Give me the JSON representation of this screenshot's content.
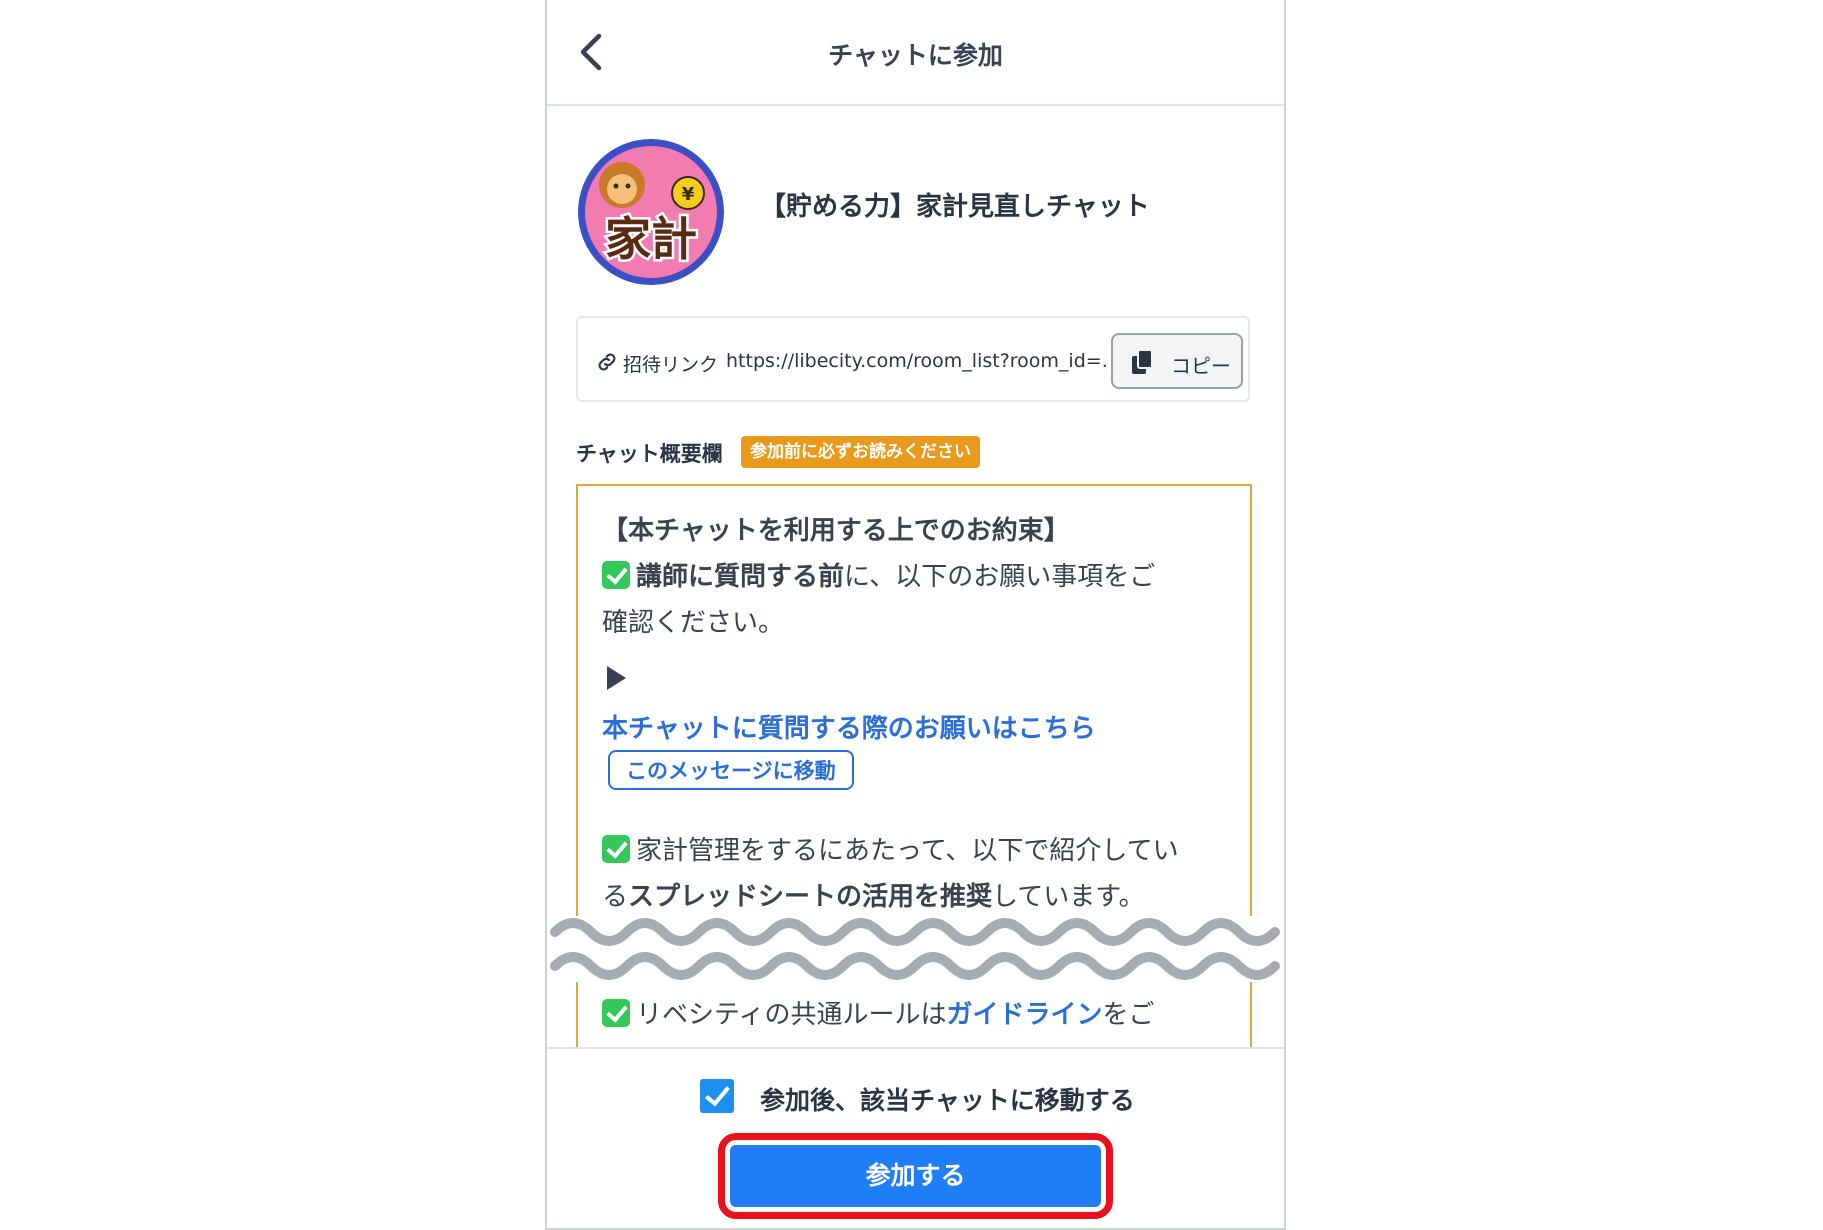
{
  "header": {
    "title": "チャットに参加",
    "back_icon": "chevron-left-icon"
  },
  "chat": {
    "name": "【貯める力】家計見直しチャット",
    "avatar_text": "家計"
  },
  "invite": {
    "label": "招待リンク",
    "url": "https://libecity.com/room_list?room_id=...",
    "copy_label": "コピー"
  },
  "summary": {
    "label": "チャット概要欄",
    "badge": "参加前に必ずお読みください",
    "heading": "【本チャットを利用する上でのお約束】",
    "item1_bold": "講師に質問する前",
    "item1_rest": "に、以下のお願い事項をご",
    "item1_line2": "確認ください。",
    "link1": "本チャットに質問する際のお願いはこちら",
    "jump_button": "このメッセージに移動",
    "item2_line1": "家計管理をするにあたって、以下で紹介してい",
    "item2_line2_pre": "る",
    "item2_line2_bold": "スプレッドシートの活用を推奨",
    "item2_line2_post": "しています。",
    "item3_pre": "リベシティの共通ルールは",
    "item3_link": "ガイドライン",
    "item3_post": "をご"
  },
  "footer": {
    "checkbox_label": "参加後、該当チャットに移動する",
    "checkbox_checked": true,
    "join_button": "参加する"
  },
  "colors": {
    "accent": "#1f7df5",
    "badge": "#e99a1c",
    "highlight": "#e8111d",
    "link": "#2b6fd6"
  }
}
